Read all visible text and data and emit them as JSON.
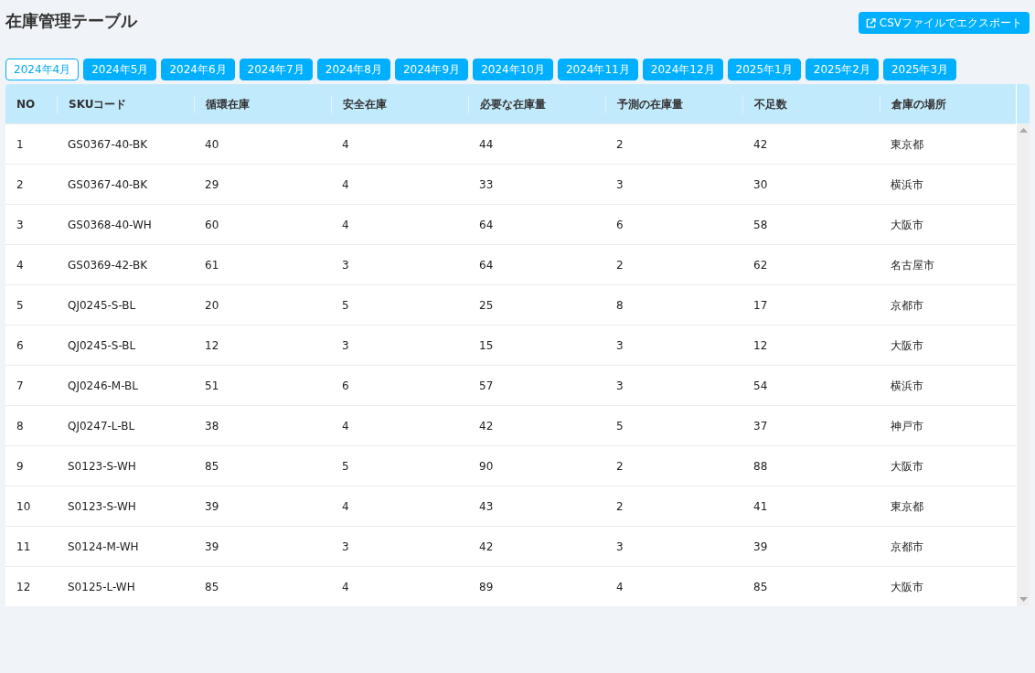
{
  "title": "在庫管理テーブル",
  "export_button": {
    "label": "CSVファイルでエクスポート"
  },
  "tabs": [
    {
      "label": "2024年4月",
      "selected": true
    },
    {
      "label": "2024年5月",
      "selected": false
    },
    {
      "label": "2024年6月",
      "selected": false
    },
    {
      "label": "2024年7月",
      "selected": false
    },
    {
      "label": "2024年8月",
      "selected": false
    },
    {
      "label": "2024年9月",
      "selected": false
    },
    {
      "label": "2024年10月",
      "selected": false
    },
    {
      "label": "2024年11月",
      "selected": false
    },
    {
      "label": "2024年12月",
      "selected": false
    },
    {
      "label": "2025年1月",
      "selected": false
    },
    {
      "label": "2025年2月",
      "selected": false
    },
    {
      "label": "2025年3月",
      "selected": false
    }
  ],
  "table": {
    "columns": [
      "NO",
      "SKUコード",
      "循環在庫",
      "安全在庫",
      "必要な在庫量",
      "予測の在庫量",
      "不足数",
      "倉庫の場所"
    ],
    "rows": [
      [
        "1",
        "GS0367-40-BK",
        "40",
        "4",
        "44",
        "2",
        "42",
        "東京都"
      ],
      [
        "2",
        "GS0367-40-BK",
        "29",
        "4",
        "33",
        "3",
        "30",
        "横浜市"
      ],
      [
        "3",
        "GS0368-40-WH",
        "60",
        "4",
        "64",
        "6",
        "58",
        "大阪市"
      ],
      [
        "4",
        "GS0369-42-BK",
        "61",
        "3",
        "64",
        "2",
        "62",
        "名古屋市"
      ],
      [
        "5",
        "QJ0245-S-BL",
        "20",
        "5",
        "25",
        "8",
        "17",
        "京都市"
      ],
      [
        "6",
        "QJ0245-S-BL",
        "12",
        "3",
        "15",
        "3",
        "12",
        "大阪市"
      ],
      [
        "7",
        "QJ0246-M-BL",
        "51",
        "6",
        "57",
        "3",
        "54",
        "横浜市"
      ],
      [
        "8",
        "QJ0247-L-BL",
        "38",
        "4",
        "42",
        "5",
        "37",
        "神戸市"
      ],
      [
        "9",
        "S0123-S-WH",
        "85",
        "5",
        "90",
        "2",
        "88",
        "大阪市"
      ],
      [
        "10",
        "S0123-S-WH",
        "39",
        "4",
        "43",
        "2",
        "41",
        "東京都"
      ],
      [
        "11",
        "S0124-M-WH",
        "39",
        "3",
        "42",
        "3",
        "39",
        "京都市"
      ],
      [
        "12",
        "S0125-L-WH",
        "85",
        "4",
        "89",
        "4",
        "85",
        "大阪市"
      ]
    ]
  }
}
